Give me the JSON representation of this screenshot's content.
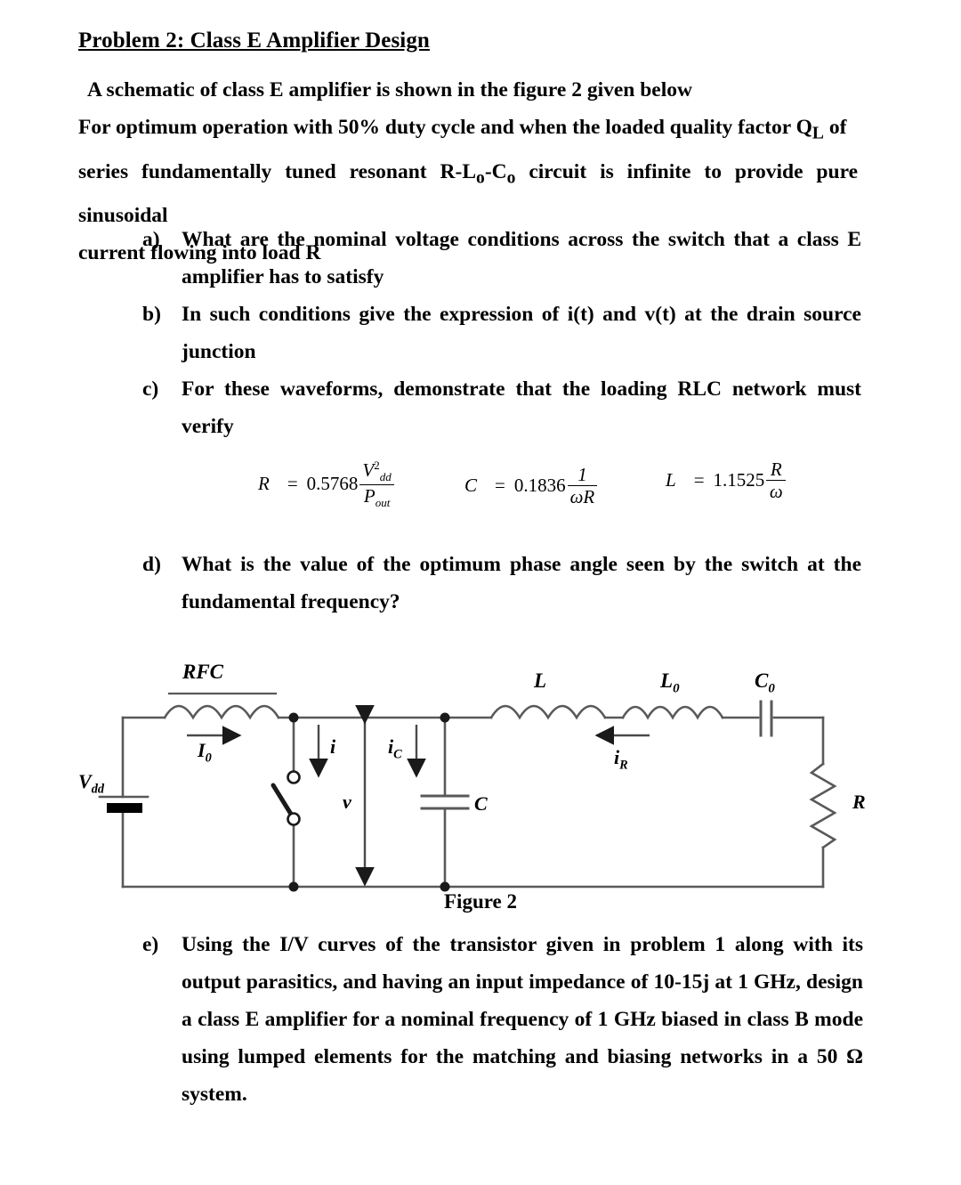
{
  "document": {
    "title": "Problem 2: Class E Amplifier Design",
    "intro": {
      "line1": "A schematic of class E amplifier is shown in the figure 2 given below",
      "line2": "For optimum operation with 50% duty cycle and when the loaded quality factor Q",
      "line2_sub": "L",
      "line2_end": " of",
      "line3_a": "series fundamentally tuned resonant R-L",
      "line3_sub1": "o",
      "line3_b": "-C",
      "line3_sub2": "o",
      "line3_c": " circuit is infinite to provide pure sinusoidal",
      "line4": "current flowing into load R"
    },
    "questions": [
      {
        "marker": "a)",
        "text": "What are the nominal voltage conditions across the switch that a class E amplifier has to satisfy"
      },
      {
        "marker": "b)",
        "text": "In such  conditions give the expression of  i(t)  and v(t) at the drain source junction"
      },
      {
        "marker": "c)",
        "text": "For these waveforms, demonstrate that   the loading  RLC  network  must verify"
      },
      {
        "marker": "d)",
        "text": "What is the value of the optimum phase angle seen by the switch at the fundamental frequency?"
      },
      {
        "marker": "e)",
        "text": "Using the I/V curves of the  transistor given in problem 1 along with its output parasitics, and having an input impedance of 10-15j  at 1 GHz, design a class E amplifier for a nominal frequency of 1 GHz biased in class B mode using lumped elements for the matching and biasing networks in  a 50 Ω system."
      }
    ],
    "formulas": [
      {
        "name": "resistance",
        "lhs": "R",
        "eq": "=",
        "coefficient": "0.5768",
        "numerator": "V",
        "numerator_sub": "dd",
        "numerator_sup": "2",
        "denominator": "P",
        "denominator_sub": "out"
      },
      {
        "name": "capacitance",
        "lhs": "C",
        "eq": "=",
        "coefficient": "0.1836",
        "numerator": "1",
        "denominator": "ωR"
      },
      {
        "name": "inductance",
        "lhs": "L",
        "eq": "=",
        "coefficient": "1.1525",
        "numerator": "R",
        "denominator": "ω"
      }
    ],
    "figure": {
      "caption": "Figure 2",
      "labels": {
        "rfc": "RFC",
        "i0": "I",
        "i0_sub": "0",
        "vdd": "V",
        "vdd_sub": "dd",
        "i_switch": "i",
        "v_node": "v",
        "ic": "i",
        "ic_sub": "C",
        "c": "C",
        "l": "L",
        "l0": "L",
        "l0_sub": "0",
        "c0": "C",
        "c0_sub": "0",
        "ir": "i",
        "ir_sub": "R",
        "r": "R"
      }
    },
    "colors": {
      "ink": "#000000",
      "wire": "#595959",
      "paper": "#ffffff"
    }
  }
}
